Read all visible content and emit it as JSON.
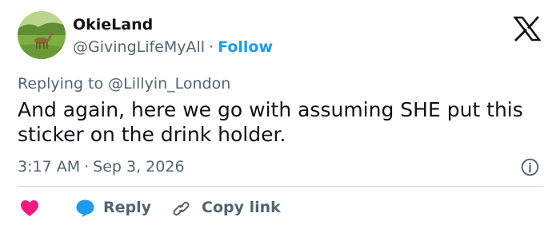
{
  "author": {
    "display_name": "OkieLand",
    "handle": "@GivingLifeMyAll",
    "separator": "·",
    "follow_label": "Follow"
  },
  "replying_to": "Replying to @Lillyin_London",
  "body": "And again, here we go with assuming SHE put this sticker on the drink holder.",
  "time": "3:17 AM",
  "time_separator": "·",
  "date": "Sep 3, 2026",
  "actions": {
    "reply_label": "Reply",
    "copy_link_label": "Copy link"
  },
  "icons": {
    "brand": "x-logo-icon",
    "info": "info-icon",
    "like": "heart-icon",
    "reply": "speech-bubble-icon",
    "copy": "link-icon"
  },
  "colors": {
    "accent": "#1d9bf0",
    "heart": "#f91880",
    "text": "#0f1419",
    "secondary": "#536471",
    "divider": "#cfd9de"
  }
}
